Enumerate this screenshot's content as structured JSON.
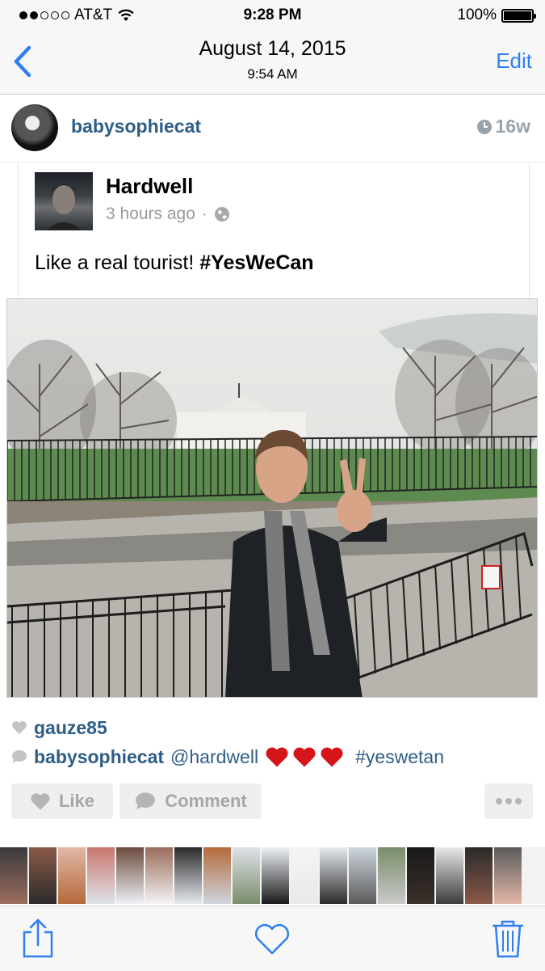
{
  "status_bar": {
    "carrier": "AT&T",
    "time": "9:28 PM",
    "battery": "100%",
    "battery_level": 1.0,
    "signal_bars": 2
  },
  "nav": {
    "title": "August 14, 2015",
    "subtitle": "9:54 AM",
    "edit_label": "Edit",
    "back_icon": "chevron-left-icon"
  },
  "instagram_post": {
    "username": "babysophiecat",
    "age": "16w",
    "embedded_facebook_post": {
      "author": "Hardwell",
      "time": "3 hours ago",
      "separator": "·",
      "text_plain": "Like a real tourist! ",
      "text_hashtag": "#YesWeCan"
    },
    "likes": {
      "user": "gauze85"
    },
    "comment": {
      "user": "babysophiecat",
      "text": "@hardwell",
      "hearts": 3,
      "hashtag": "#yeswetan"
    },
    "actions": {
      "like_label": "Like",
      "comment_label": "Comment",
      "more_icon": "ellipsis-icon"
    }
  },
  "thumbnail_strip": {
    "count": 18
  },
  "toolbar": {
    "share_icon": "share-icon",
    "favorite_icon": "heart-icon",
    "delete_icon": "trash-icon"
  },
  "colors": {
    "accent": "#2f7ff0",
    "ig_link": "#2e5e86",
    "heart": "#d6151b",
    "muted": "#9aa3ab"
  }
}
